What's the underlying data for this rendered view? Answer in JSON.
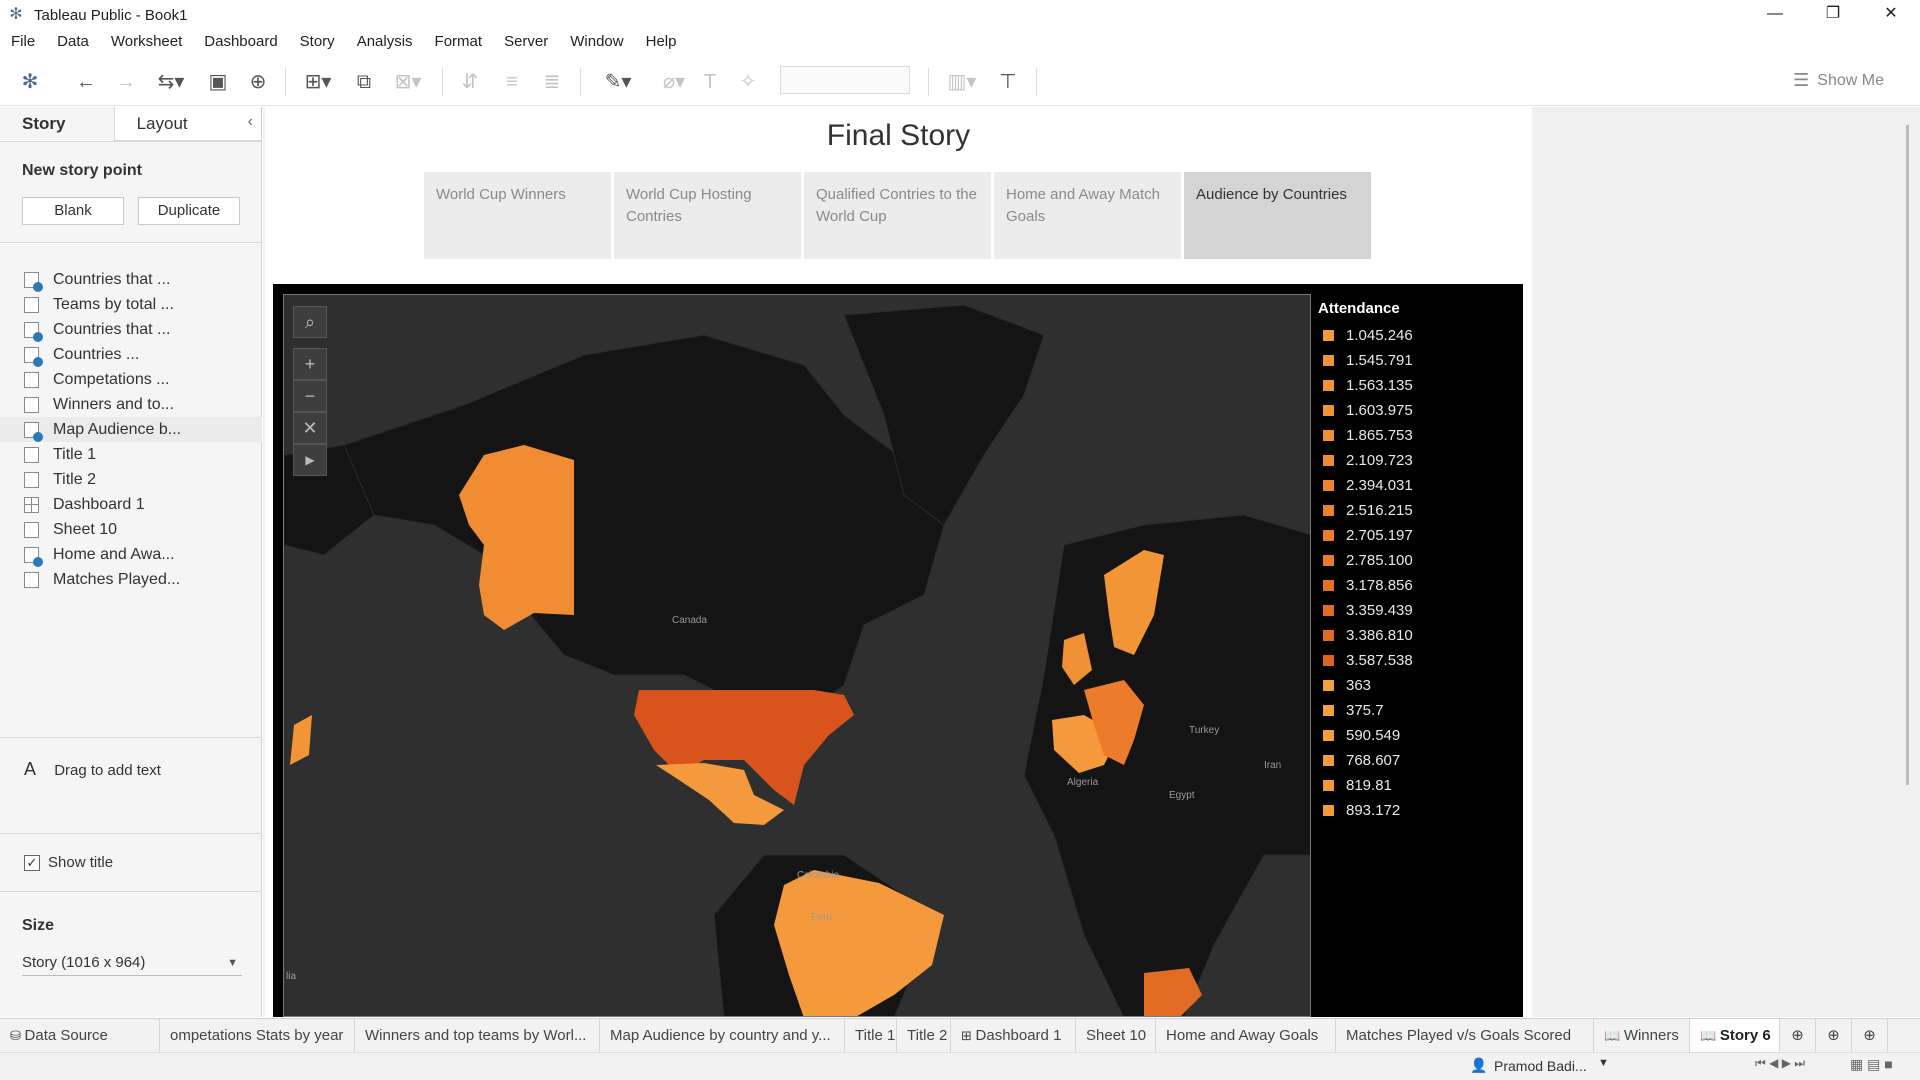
{
  "window": {
    "title": "Tableau Public - Book1",
    "minimize": "—",
    "restore": "❐",
    "close": "✕"
  },
  "menu": [
    "File",
    "Data",
    "Worksheet",
    "Dashboard",
    "Story",
    "Analysis",
    "Format",
    "Server",
    "Window",
    "Help"
  ],
  "toolbar": {
    "show_me": "Show Me"
  },
  "left_pane": {
    "tab_story": "Story",
    "tab_layout": "Layout",
    "new_story_point": "New story point",
    "blank_button": "Blank",
    "duplicate_button": "Duplicate",
    "sheets": [
      {
        "label": "Countries that ...",
        "icon": "worksheet",
        "checked": true
      },
      {
        "label": "Teams by total ...",
        "icon": "worksheet",
        "checked": false
      },
      {
        "label": " Countries that ...",
        "icon": "worksheet",
        "checked": true
      },
      {
        "label": "Countries ...",
        "icon": "worksheet",
        "checked": true
      },
      {
        "label": "Competations ...",
        "icon": "worksheet",
        "checked": false
      },
      {
        "label": "Winners and to...",
        "icon": "worksheet",
        "checked": false
      },
      {
        "label": "Map Audience b...",
        "icon": "worksheet",
        "checked": true
      },
      {
        "label": "Title 1",
        "icon": "worksheet",
        "checked": false
      },
      {
        "label": "Title 2",
        "icon": "worksheet",
        "checked": false
      },
      {
        "label": "Dashboard 1",
        "icon": "dashboard",
        "checked": false
      },
      {
        "label": "Sheet 10",
        "icon": "worksheet",
        "checked": false
      },
      {
        "label": "Home and Awa...",
        "icon": "worksheet",
        "checked": true
      },
      {
        "label": "Matches Played...",
        "icon": "worksheet",
        "checked": false
      }
    ],
    "drag_text": "Drag to add text",
    "show_title": "Show title",
    "size_label": "Size",
    "size_value": "Story (1016 x 964)"
  },
  "story": {
    "title": "Final Story",
    "points": [
      {
        "label": "World Cup Winners",
        "active": false
      },
      {
        "label": "World Cup Hosting Contries",
        "active": false
      },
      {
        "label": "Qualified Contries to the World Cup",
        "active": false
      },
      {
        "label": "Home and Away Match Goals",
        "active": false
      },
      {
        "label": "Audience by Countries",
        "active": true
      }
    ]
  },
  "map": {
    "place_labels": [
      "Canada",
      "Turkey",
      "Iran",
      "Algeria",
      "Egypt",
      "Colombia",
      "Peru",
      "lia"
    ],
    "colors": {
      "ocean": "#2f2f2f",
      "land": "#121212",
      "light": "#f49a3c",
      "mid": "#ec7b2b",
      "dark": "#d9541c"
    }
  },
  "legend": {
    "title": "Attendance",
    "items": [
      {
        "label": "1.045.246",
        "color": "#f39b3a"
      },
      {
        "label": "1.545.791",
        "color": "#f29537"
      },
      {
        "label": "1.563.135",
        "color": "#f29537"
      },
      {
        "label": "1.603.975",
        "color": "#f29436"
      },
      {
        "label": "1.865.753",
        "color": "#f18f34"
      },
      {
        "label": "2.109.723",
        "color": "#ef8932"
      },
      {
        "label": "2.394.031",
        "color": "#ee8430"
      },
      {
        "label": "2.516.215",
        "color": "#ed812e"
      },
      {
        "label": "2.705.197",
        "color": "#ec7d2c"
      },
      {
        "label": "2.785.100",
        "color": "#eb7b2b"
      },
      {
        "label": "3.178.856",
        "color": "#e57125"
      },
      {
        "label": "3.359.439",
        "color": "#e16b22"
      },
      {
        "label": "3.386.810",
        "color": "#e06a22"
      },
      {
        "label": "3.587.538",
        "color": "#dc641f"
      },
      {
        "label": "363",
        "color": "#f4a03e"
      },
      {
        "label": "375.7",
        "color": "#f4a03e"
      },
      {
        "label": "590.549",
        "color": "#f49d3d"
      },
      {
        "label": "768.607",
        "color": "#f39c3c"
      },
      {
        "label": "819.81",
        "color": "#f39b3b"
      },
      {
        "label": "893.172",
        "color": "#f39b3b"
      }
    ]
  },
  "bottom_tabs": [
    {
      "label": "Data Source",
      "icon": "db",
      "active": false
    },
    {
      "label": "ompetations Stats by year",
      "icon": "",
      "active": false
    },
    {
      "label": "Winners and top teams by Worl...",
      "icon": "",
      "active": false
    },
    {
      "label": "Map Audience by country and y...",
      "icon": "",
      "active": false
    },
    {
      "label": "Title 1",
      "icon": "",
      "active": false
    },
    {
      "label": "Title 2",
      "icon": "",
      "active": false
    },
    {
      "label": "Dashboard 1",
      "icon": "dash",
      "active": false
    },
    {
      "label": "Sheet 10",
      "icon": "",
      "active": false
    },
    {
      "label": "Home and Away Goals",
      "icon": "",
      "active": false
    },
    {
      "label": "Matches Played v/s Goals Scored",
      "icon": "",
      "active": false
    },
    {
      "label": "Winners",
      "icon": "book",
      "active": false
    },
    {
      "label": "Story 6",
      "icon": "book",
      "active": true
    }
  ],
  "status": {
    "user": "Pramod Badi..."
  }
}
